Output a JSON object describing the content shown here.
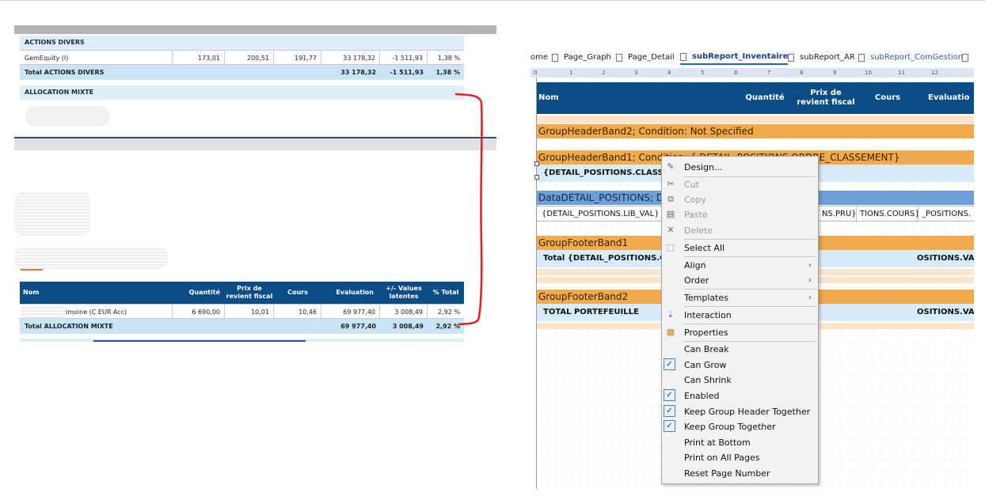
{
  "report": {
    "section1": "ACTIONS DIVERS",
    "row1": [
      "GemEquity (I)",
      "173,01",
      "200,51",
      "191,77",
      "33 178,32",
      "-1 511,93",
      "1,38 %"
    ],
    "total1": [
      "Total ACTIONS DIVERS",
      "33 178,32",
      "-1 511,93",
      "1,38 %"
    ],
    "section2": "ALLOCATION MIXTE",
    "headers": [
      "Nom",
      "Quantité",
      "Prix de revient fiscal",
      "Cours",
      "Evaluation",
      "+/- Values latentes",
      "% Total"
    ],
    "row2": [
      "imoine (C EUR Acc)",
      "6 690,00",
      "10,01",
      "10,46",
      "69 977,40",
      "3 008,49",
      "2,92 %"
    ],
    "total2": [
      "Total ALLOCATION MIXTE",
      "69 977,40",
      "3 008,49",
      "2,92 %"
    ]
  },
  "designer": {
    "tabs": [
      {
        "label": "ome"
      },
      {
        "label": "Page_Graph"
      },
      {
        "label": "Page_Detail"
      },
      {
        "label": "subReport_Inventaire"
      },
      {
        "label": "subReport_AR"
      },
      {
        "label": "subReport_ComGestion"
      }
    ],
    "ruler": [
      "0",
      "1",
      "2",
      "3",
      "4",
      "5",
      "6",
      "7",
      "8",
      "9",
      "10",
      "11",
      "12"
    ],
    "headers": [
      "Nom",
      "Quantité",
      "Prix de revient fiscal",
      "Cours",
      "Evaluatio"
    ],
    "bands": {
      "gh2": "GroupHeaderBand2; Condition: Not Specified",
      "gh1": "GroupHeaderBand1; Condition: { DETAIL_POSITIONS.ORDRE_CLASSEMENT}",
      "gh1_field": "{DETAIL_POSITIONS.CLASSIFIC",
      "data": "DataDETAIL_POSITIONS; Da",
      "data_cells": [
        "{DETAIL_POSITIONS.LIB_VAL}",
        "NS.PRU}",
        "TIONS.COURS}",
        "_POSITIONS."
      ],
      "gf1": "GroupFooterBand1",
      "gf1_field": "Total {DETAIL_POSITIONS.CL",
      "gf1_right": "OSITIONS.VA",
      "gf2": "GroupFooterBand2",
      "gf2_field": "TOTAL PORTEFEUILLE",
      "gf2_right": "OSITIONS.VA"
    }
  },
  "menu": {
    "design": "Design...",
    "cut": "Cut",
    "copy": "Copy",
    "paste": "Paste",
    "delete": "Delete",
    "select_all": "Select All",
    "align": "Align",
    "order": "Order",
    "templates": "Templates",
    "interaction": "Interaction",
    "properties": "Properties",
    "can_break": "Can Break",
    "can_grow": "Can Grow",
    "can_shrink": "Can Shrink",
    "enabled": "Enabled",
    "keep_group_header": "Keep Group Header Together",
    "keep_group": "Keep Group Together",
    "print_bottom": "Print at Bottom",
    "print_all": "Print on All Pages",
    "reset_page": "Reset Page Number"
  },
  "colors": {
    "header_blue": "#0c4d86",
    "band_orange": "#f0a94b",
    "band_blue": "#6e9fd6",
    "annotation_red": "#e02020"
  }
}
